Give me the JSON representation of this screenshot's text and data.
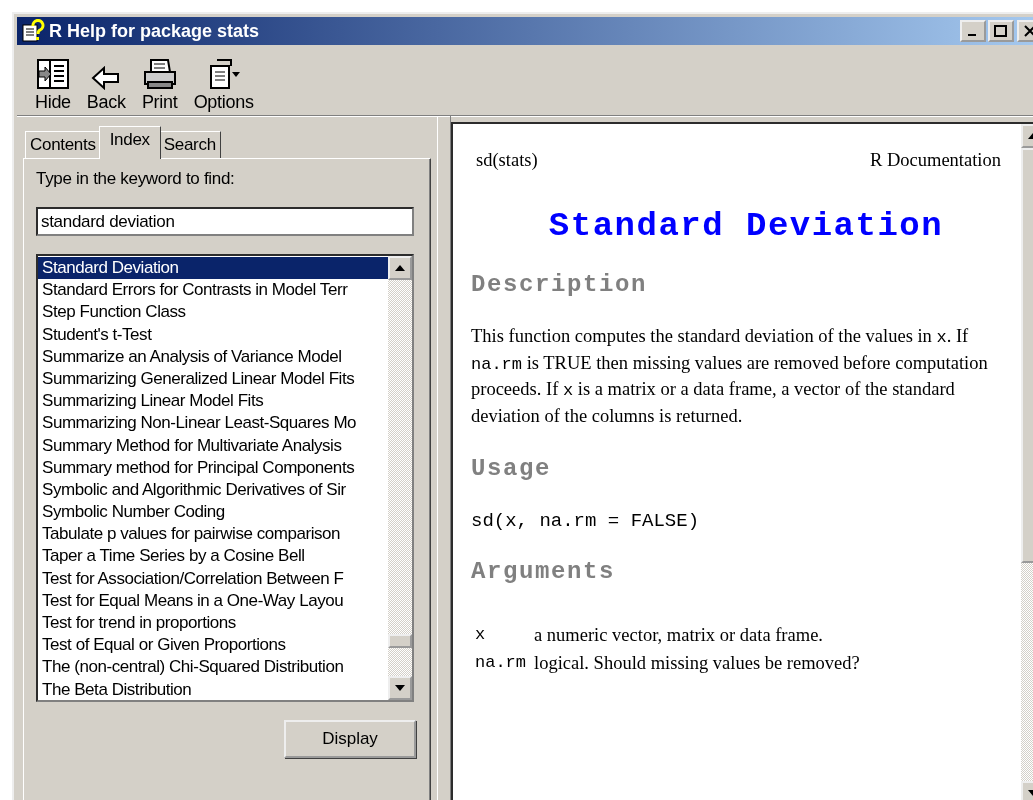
{
  "window": {
    "title": "R Help for package stats"
  },
  "toolbar": [
    {
      "label": "Hide",
      "kind": "hide"
    },
    {
      "label": "Back",
      "kind": "back"
    },
    {
      "label": "Print",
      "kind": "print"
    },
    {
      "label": "Options",
      "kind": "options"
    }
  ],
  "tabs": [
    {
      "label": "Contents",
      "selected": false
    },
    {
      "label": "Index",
      "selected": true
    },
    {
      "label": "Search",
      "selected": false
    }
  ],
  "index": {
    "prompt": "Type in the keyword to find:",
    "keyword": "standard deviation",
    "button": "Display",
    "items": [
      {
        "label": "Standard Deviation",
        "selected": true
      },
      {
        "label": "Standard Errors for Contrasts in Model Terr",
        "selected": false
      },
      {
        "label": "Step Function Class",
        "selected": false
      },
      {
        "label": "Student's t-Test",
        "selected": false
      },
      {
        "label": "Summarize an Analysis of Variance Model",
        "selected": false
      },
      {
        "label": "Summarizing Generalized Linear Model Fits",
        "selected": false
      },
      {
        "label": "Summarizing Linear Model Fits",
        "selected": false
      },
      {
        "label": "Summarizing Non-Linear Least-Squares Mo",
        "selected": false
      },
      {
        "label": "Summary Method for Multivariate Analysis",
        "selected": false
      },
      {
        "label": "Summary method for Principal Components",
        "selected": false
      },
      {
        "label": "Symbolic and Algorithmic Derivatives of Sir",
        "selected": false
      },
      {
        "label": "Symbolic Number Coding",
        "selected": false
      },
      {
        "label": "Tabulate p values for pairwise comparison",
        "selected": false
      },
      {
        "label": "Taper a Time Series by a Cosine Bell",
        "selected": false
      },
      {
        "label": "Test for Association/Correlation Between F",
        "selected": false
      },
      {
        "label": "Test for Equal Means in a One-Way Layou",
        "selected": false
      },
      {
        "label": "Test for trend in proportions",
        "selected": false
      },
      {
        "label": "Test of Equal or Given Proportions",
        "selected": false
      },
      {
        "label": "The (non-central) Chi-Squared Distribution",
        "selected": false
      },
      {
        "label": "The Beta Distribution",
        "selected": false
      }
    ]
  },
  "document": {
    "topic": "sd(stats)",
    "source": "R Documentation",
    "title": "Standard Deviation",
    "sections": [
      {
        "heading": "Description",
        "kind": "text",
        "parts": [
          {
            "text": "This function computes the standard deviation of the values in ",
            "code": false
          },
          {
            "text": "x",
            "code": true
          },
          {
            "text": ". If ",
            "code": false
          },
          {
            "text": "na.rm",
            "code": true
          },
          {
            "text": " is TRUE then missing values are removed before computation proceeds. If ",
            "code": false
          },
          {
            "text": "x",
            "code": true
          },
          {
            "text": " is a matrix or a data frame, a vector of the standard deviation of the columns is returned.",
            "code": false
          }
        ]
      },
      {
        "heading": "Usage",
        "kind": "code",
        "code": "sd(x, na.rm = FALSE)"
      },
      {
        "heading": "Arguments",
        "kind": "arguments",
        "arguments": [
          {
            "name": "x",
            "description": "a numeric vector, matrix or data frame."
          },
          {
            "name": "na.rm",
            "description": "logical. Should missing values be removed?"
          }
        ]
      }
    ]
  }
}
